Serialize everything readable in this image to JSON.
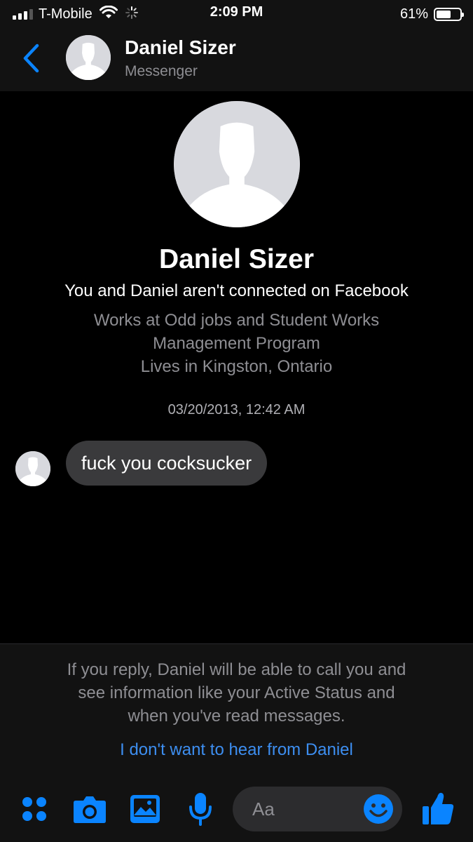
{
  "status_bar": {
    "carrier": "T-Mobile",
    "time": "2:09 PM",
    "battery_percent": "61%",
    "battery_level": 0.61,
    "signal_bars_active": 3,
    "signal_bars_total": 4,
    "icons": [
      "signal-icon",
      "wifi-icon",
      "activity-spinner-icon",
      "battery-icon"
    ]
  },
  "header": {
    "name": "Daniel Sizer",
    "subtitle": "Messenger",
    "back_icon": "chevron-left-icon"
  },
  "profile": {
    "name": "Daniel Sizer",
    "connection_text": "You and Daniel aren't connected on Facebook",
    "details": [
      "Works at Odd jobs and Student Works",
      "Management Program",
      "Lives in Kingston, Ontario"
    ]
  },
  "conversation": {
    "timestamp": "03/20/2013, 12:42 AM",
    "messages": [
      {
        "text": "fuck you cocksucker"
      }
    ]
  },
  "notice": {
    "lines": [
      "If you reply, Daniel will be able to call you and",
      "see information like your Active Status and",
      "when you've read messages."
    ],
    "link_text": "I don't want to hear from Daniel"
  },
  "composer": {
    "placeholder": "Aa",
    "icons": [
      "more-actions-icon",
      "camera-icon",
      "photo-icon",
      "microphone-icon",
      "emoji-icon",
      "thumbs-up-icon"
    ]
  },
  "colors": {
    "accent": "#0a84ff",
    "link": "#3d8ef0",
    "background": "#000000",
    "panel": "#121212",
    "bubble": "#3a3a3c",
    "secondary_text": "#8e8e93"
  }
}
